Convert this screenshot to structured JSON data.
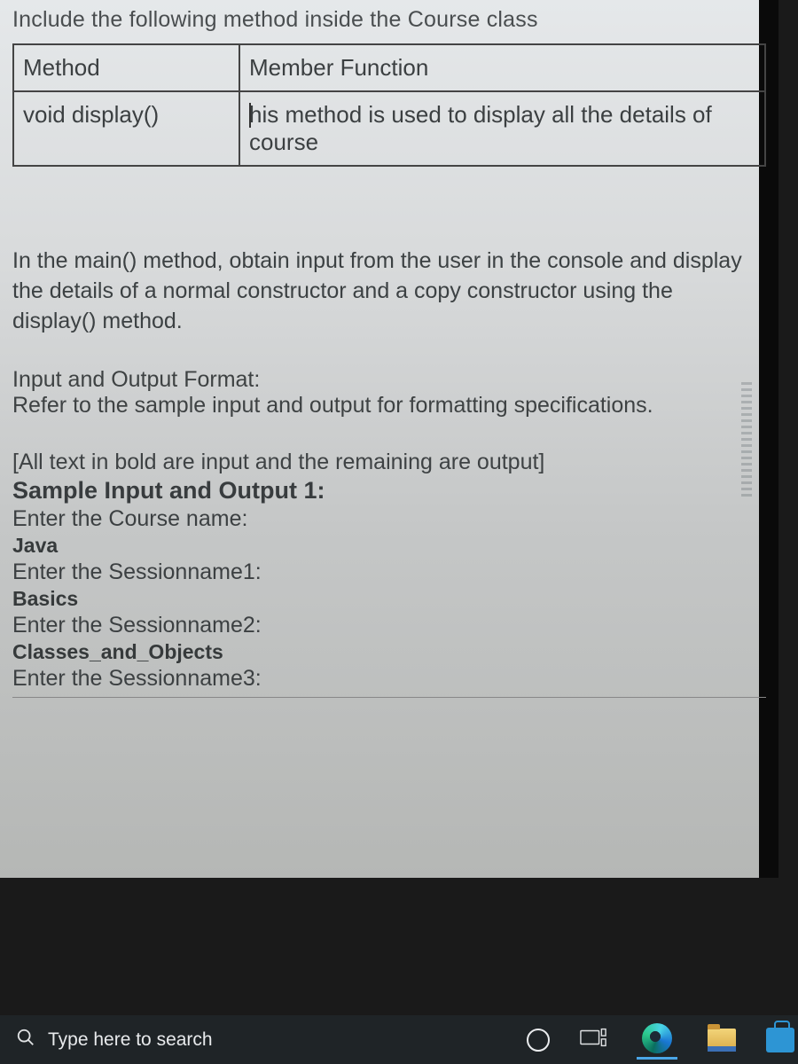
{
  "document": {
    "heading": "Include the following method inside the Course class",
    "table": {
      "header": {
        "c1": "Method",
        "c2": "Member Function"
      },
      "row": {
        "c1": "void display()",
        "c2a": "his method is used to display all the details of",
        "c2b": "course"
      }
    },
    "para1": "In the main() method, obtain input from the user in the console and display the details of a normal constructor and a copy constructor using the display() method.",
    "ioHead": "Input and Output Format:",
    "ioLine": "Refer to the sample input and output for formatting specifications.",
    "bracket": "[All text in bold are input and the remaining are output]",
    "sampleHead": "Sample Input and Output 1:",
    "lines": {
      "p1": "Enter the Course name:",
      "i1": "Java",
      "p2": "Enter the Sessionname1:",
      "i2": "Basics",
      "p3": "Enter the Sessionname2:",
      "i3": "Classes_and_Objects",
      "p4": "Enter the Sessionname3:"
    }
  },
  "taskbar": {
    "searchPlaceholder": "Type here to search"
  }
}
